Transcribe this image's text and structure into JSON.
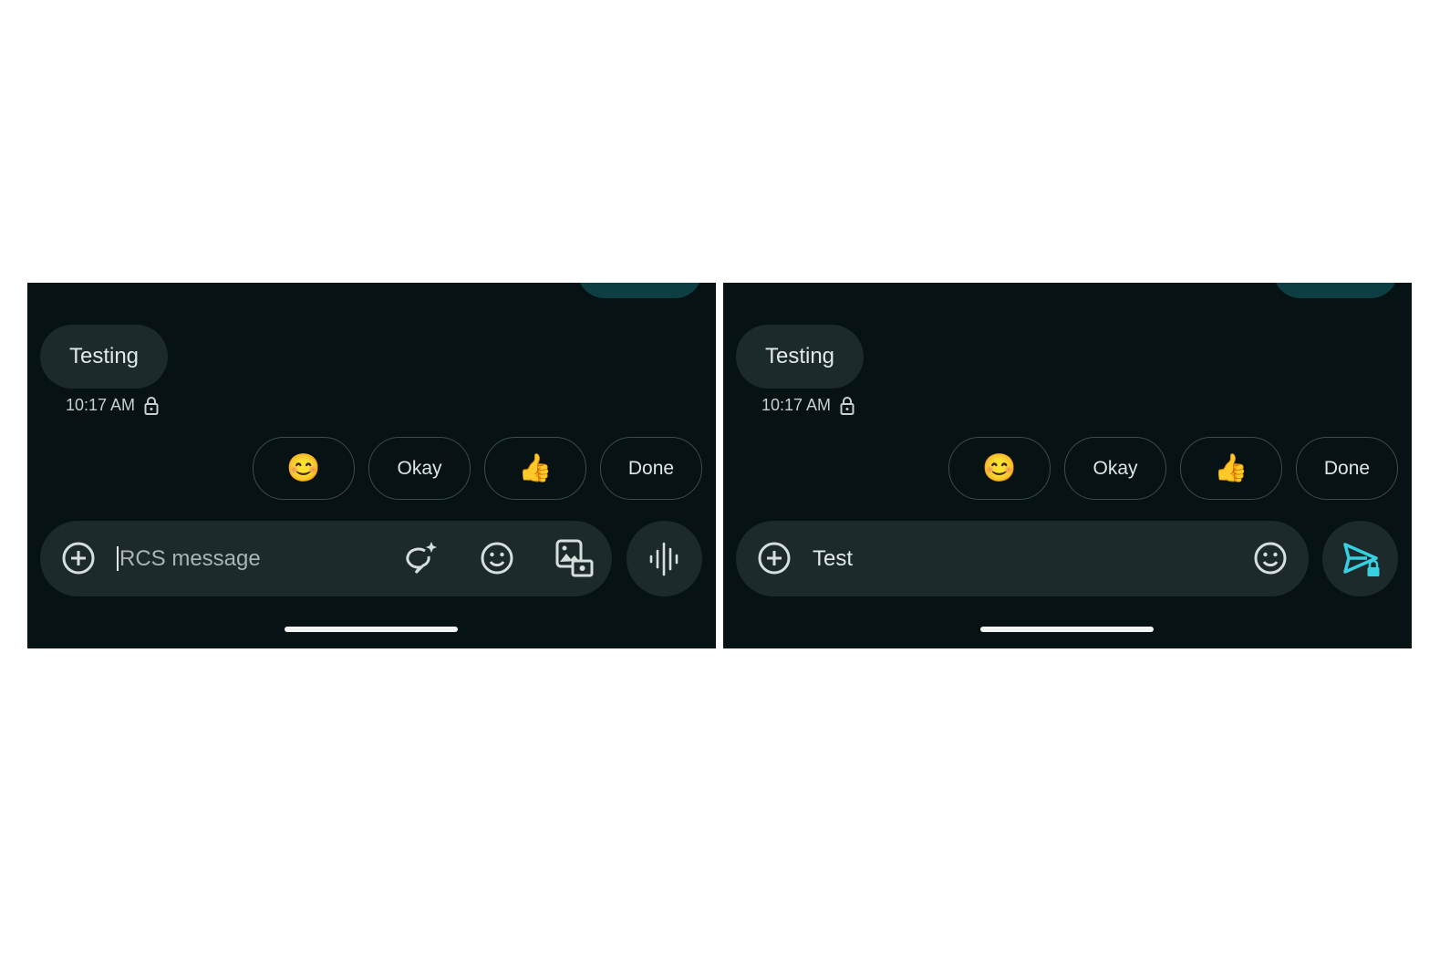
{
  "colors": {
    "background": "#061214",
    "bubble": "#1c2a2b",
    "accent": "#36d0e0"
  },
  "panels": [
    {
      "message": {
        "text": "Testing",
        "time": "10:17 AM"
      },
      "suggestions": [
        "😊",
        "Okay",
        "👍",
        "Done"
      ],
      "compose": {
        "placeholder": "RCS message",
        "value": ""
      },
      "icons": [
        "add-icon",
        "magic-compose-icon",
        "emoji-icon",
        "gallery-icon",
        "voice-icon"
      ]
    },
    {
      "message": {
        "text": "Testing",
        "time": "10:17 AM"
      },
      "suggestions": [
        "😊",
        "Okay",
        "👍",
        "Done"
      ],
      "compose": {
        "value": "Test"
      },
      "icons": [
        "add-icon",
        "emoji-icon",
        "send-encrypted-icon"
      ]
    }
  ]
}
